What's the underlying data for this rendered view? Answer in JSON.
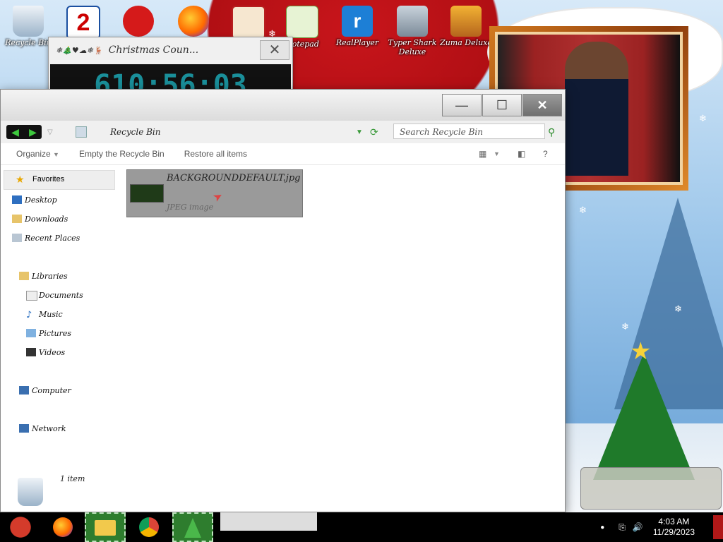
{
  "desktop": {
    "icons": [
      {
        "label": "Recycle Bin"
      },
      {
        "label": ""
      },
      {
        "label": ""
      },
      {
        "label": ""
      },
      {
        "label": ""
      },
      {
        "label": "Notepad"
      },
      {
        "label": "RealPlayer"
      },
      {
        "label": "Typer Shark Deluxe"
      },
      {
        "label": "Zuma Deluxe"
      }
    ]
  },
  "gadget": {
    "title": "Christmas Coun...",
    "symbols": "❄🎄♥☁❄🦌",
    "countdown": "610:56:03",
    "close_icon": "✕"
  },
  "explorer": {
    "window": {
      "minimize": "—",
      "maximize": "☐",
      "close": "✕"
    },
    "address": "Recycle Bin",
    "search_placeholder": "Search Recycle Bin",
    "commands": {
      "organize": "Organize",
      "empty": "Empty the Recycle Bin",
      "restore": "Restore all items",
      "help": "?"
    },
    "nav": {
      "favorites": "Favorites",
      "desktop": "Desktop",
      "downloads": "Downloads",
      "recent": "Recent Places",
      "libraries": "Libraries",
      "documents": "Documents",
      "music": "Music",
      "pictures": "Pictures",
      "videos": "Videos",
      "computer": "Computer",
      "network": "Network"
    },
    "file": {
      "name": "BACKGROUNDDEFAULT.jpg",
      "type": "JPEG image"
    },
    "status": "1 item"
  },
  "taskbar": {
    "time": "4:03 AM",
    "date": "11/29/2023"
  },
  "colors": {
    "accent_green": "#2e7d2e",
    "wallpaper_red": "#c8151b",
    "sky_blue": "#9cc6ea"
  }
}
